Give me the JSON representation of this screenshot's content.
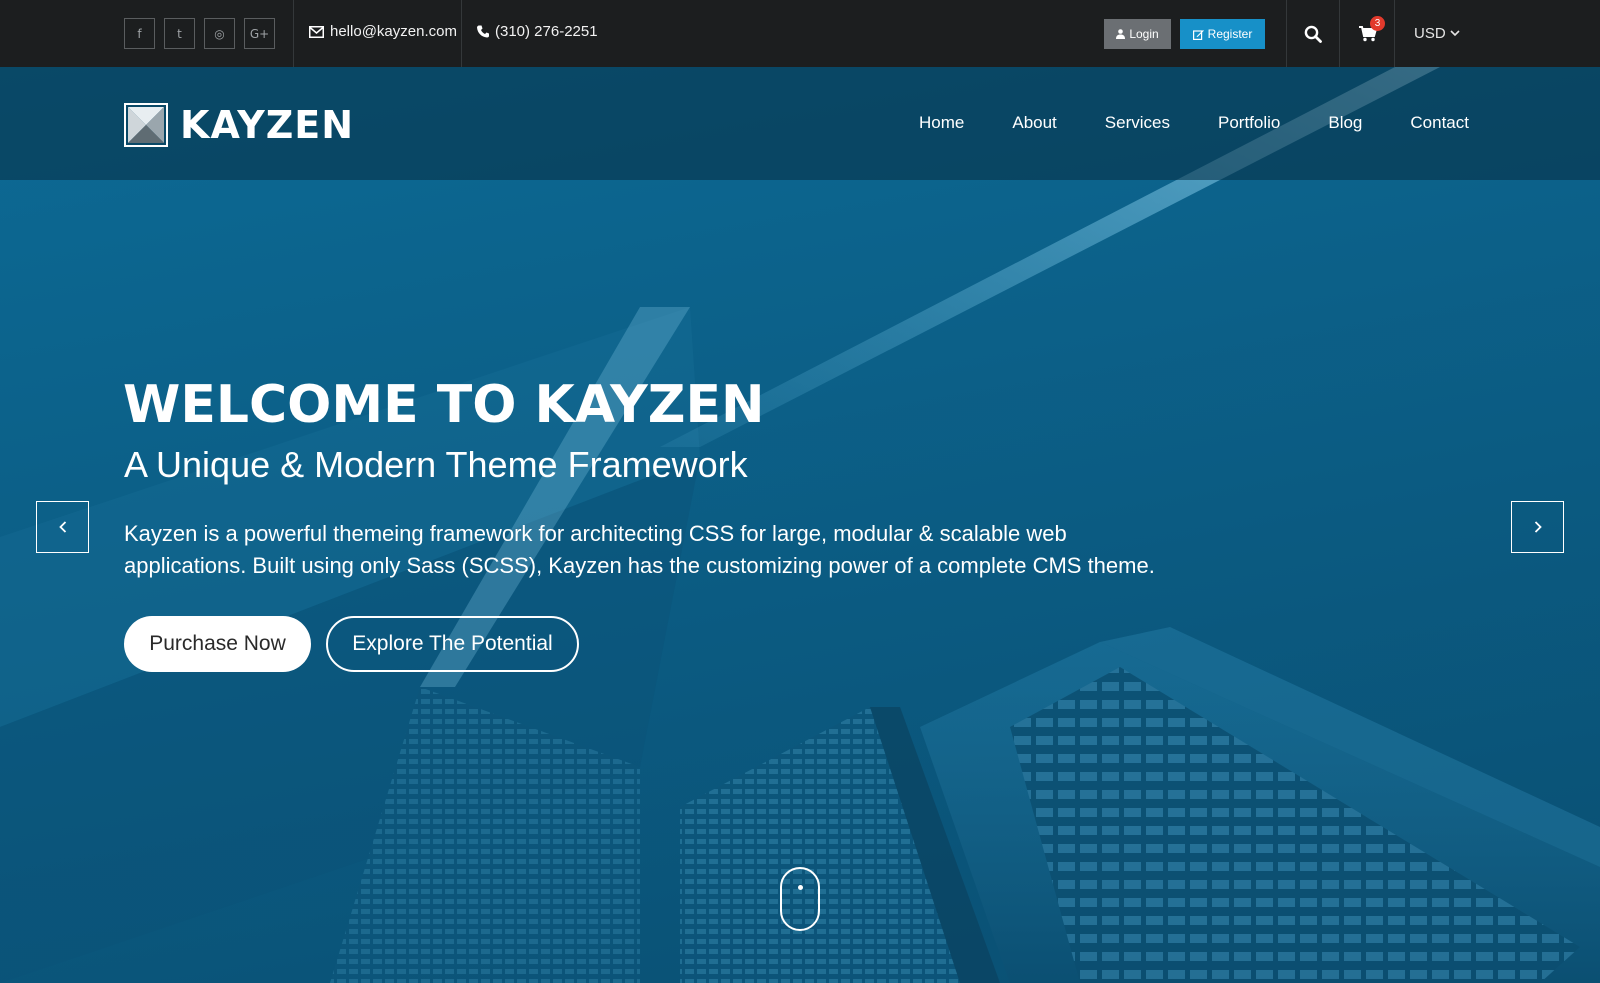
{
  "topbar": {
    "social": [
      {
        "name": "facebook-icon",
        "glyph": "f"
      },
      {
        "name": "twitter-icon",
        "glyph": "t"
      },
      {
        "name": "dribbble-icon",
        "glyph": "◎"
      },
      {
        "name": "google-plus-icon",
        "glyph": "G+"
      }
    ],
    "email": "hello@kayzen.com",
    "phone": "(310) 276-2251",
    "login_label": "Login",
    "register_label": "Register",
    "cart_count": "3",
    "currency": "USD"
  },
  "brand": {
    "name": "KAYZEN"
  },
  "nav": {
    "items": [
      "Home",
      "About",
      "Services",
      "Portfolio",
      "Blog",
      "Contact"
    ]
  },
  "hero": {
    "title": "WELCOME TO KAYZEN",
    "subtitle": "A Unique & Modern Theme Framework",
    "description": "Kayzen is a powerful themeing framework for architecting CSS for large, modular & scalable web applications. Built using only Sass (SCSS), Kayzen has the customizing power of a complete CMS theme.",
    "primary_button": "Purchase Now",
    "secondary_button": "Explore The Potential"
  },
  "colors": {
    "topbar_bg": "#1c1e1f",
    "hero_blue": "#0b5b82",
    "register_blue": "#1790c8",
    "login_gray": "#6b6f73",
    "badge_red": "#e23a2c"
  }
}
